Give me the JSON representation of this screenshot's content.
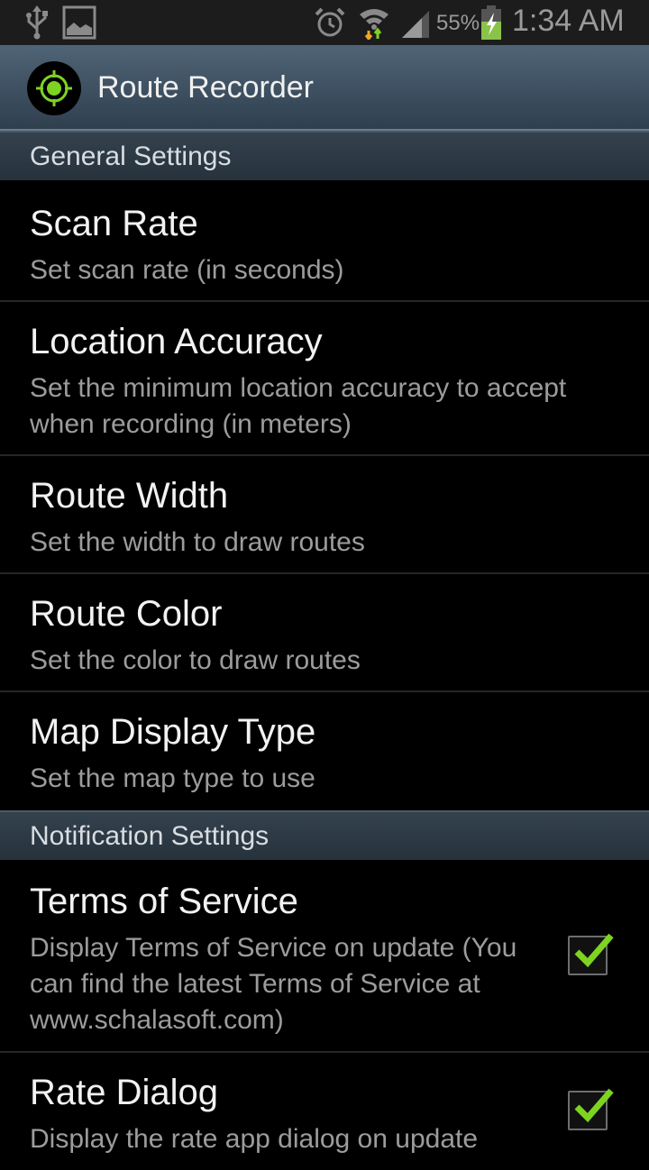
{
  "status_bar": {
    "left_icons": [
      "usb-icon",
      "image-icon"
    ],
    "right_icons": [
      "alarm-icon",
      "wifi-icon",
      "signal-icon",
      "battery-charging-icon"
    ],
    "battery": "55%",
    "time": "1:34 AM"
  },
  "action_bar": {
    "icon": "target-icon",
    "title": "Route Recorder",
    "accent": "#7ed321"
  },
  "sections": [
    {
      "header": "General Settings",
      "items": [
        {
          "title": "Scan Rate",
          "summary": "Set scan rate (in seconds)"
        },
        {
          "title": "Location Accuracy",
          "summary": "Set the minimum location accuracy to accept when recording (in meters)"
        },
        {
          "title": "Route Width",
          "summary": "Set the width to draw routes"
        },
        {
          "title": "Route Color",
          "summary": "Set the color to draw routes"
        },
        {
          "title": "Map Display Type",
          "summary": "Set the map type to use"
        }
      ]
    },
    {
      "header": "Notification Settings",
      "items": [
        {
          "title": "Terms of Service",
          "summary": "Display Terms of Service on update (You can find the latest Terms of Service at www.schalasoft.com)",
          "checked": true
        },
        {
          "title": "Rate Dialog",
          "summary": "Display the rate app dialog on update",
          "checked": true
        }
      ]
    }
  ]
}
